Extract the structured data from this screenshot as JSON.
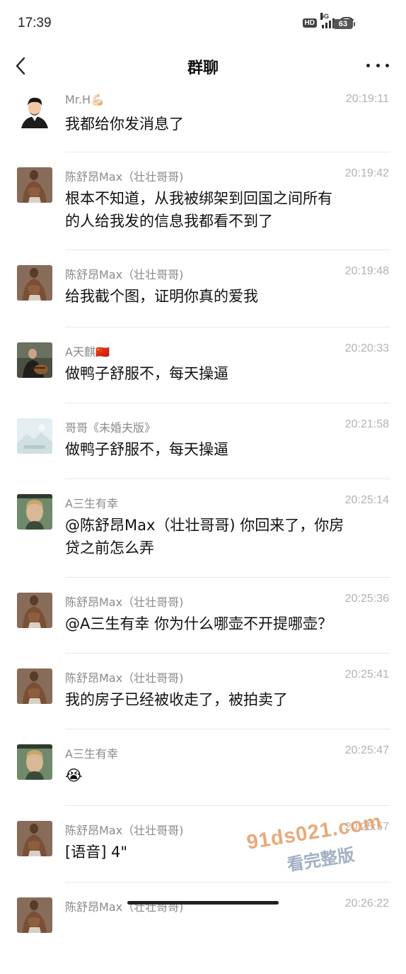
{
  "status_bar": {
    "time": "17:39",
    "network_badge": "HD",
    "network_type": "5G",
    "battery_level": "63"
  },
  "nav": {
    "title": "群聊",
    "back_icon": "chevron-left-icon",
    "more_icon": "more-dots-icon"
  },
  "messages": [
    {
      "sender": "Mr.H💪🏻",
      "time": "20:19:11",
      "lines": [
        "我都给你发消息了"
      ],
      "avatar": "man-cartoon-avatar"
    },
    {
      "sender": "陈舒昂Max（壮壮哥哥)",
      "time": "20:19:42",
      "lines": [
        "根本不知道，从我被绑架到回国之间所有",
        "的人给我发的信息我都看不到了"
      ],
      "avatar": "shirtless-man-avatar"
    },
    {
      "sender": "陈舒昂Max（壮壮哥哥)",
      "time": "20:19:48",
      "lines": [
        "给我截个图，证明你真的爱我"
      ],
      "avatar": "shirtless-man-avatar"
    },
    {
      "sender": "A天麒🇨🇳",
      "time": "20:20:33",
      "lines": [
        "做鸭子舒服不，每天操逼"
      ],
      "avatar": "man-with-guitar-avatar"
    },
    {
      "sender": "哥哥《未婚夫版》",
      "time": "20:21:58",
      "lines": [
        "做鸭子舒服不，每天操逼"
      ],
      "avatar": "landscape-placeholder-avatar"
    },
    {
      "sender": "A三生有幸",
      "time": "20:25:14",
      "lines": [
        "@陈舒昂Max（壮壮哥哥) 你回来了，你房",
        "贷之前怎么弄"
      ],
      "avatar": "blond-man-avatar"
    },
    {
      "sender": "陈舒昂Max（壮壮哥哥)",
      "time": "20:25:36",
      "lines": [
        "@A三生有幸 你为什么哪壶不开提哪壶？"
      ],
      "avatar": "shirtless-man-avatar"
    },
    {
      "sender": "陈舒昂Max（壮壮哥哥)",
      "time": "20:25:41",
      "lines": [
        "我的房子已经被收走了，被拍卖了"
      ],
      "avatar": "shirtless-man-avatar"
    },
    {
      "sender": "A三生有幸",
      "time": "20:25:47",
      "lines": [
        "😭"
      ],
      "avatar": "blond-man-avatar"
    },
    {
      "sender": "陈舒昂Max（壮壮哥哥)",
      "time": "20:25:57",
      "lines": [
        "[语音] 4\""
      ],
      "avatar": "shirtless-man-avatar"
    },
    {
      "sender": "陈舒昂Max（壮壮哥哥)",
      "time": "20:26:22",
      "lines": [
        ""
      ],
      "avatar": "shirtless-man-avatar"
    }
  ],
  "watermark": {
    "line1": "91ds021.com",
    "line2": "看完整版"
  }
}
